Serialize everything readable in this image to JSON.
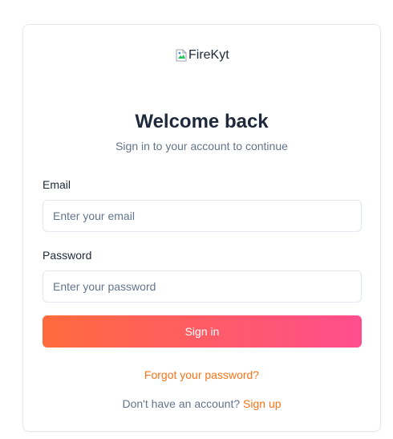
{
  "logo": {
    "alt_text": "FireKyt",
    "icon": "broken-image-icon"
  },
  "heading": {
    "title": "Welcome back",
    "subtitle": "Sign in to your account to continue"
  },
  "form": {
    "email": {
      "label": "Email",
      "placeholder": "Enter your email",
      "value": ""
    },
    "password": {
      "label": "Password",
      "placeholder": "Enter your password",
      "value": ""
    },
    "submit_label": "Sign in"
  },
  "links": {
    "forgot_password": "Forgot your password?",
    "signup_prompt": "Don't have an account?",
    "signup_label": "Sign up"
  },
  "colors": {
    "accent": "#f97316",
    "button_gradient_start": "#ff6b3d",
    "button_gradient_end": "#ff4d8d",
    "heading": "#1e293b",
    "muted": "#64748b",
    "border": "#e2e8f0"
  }
}
